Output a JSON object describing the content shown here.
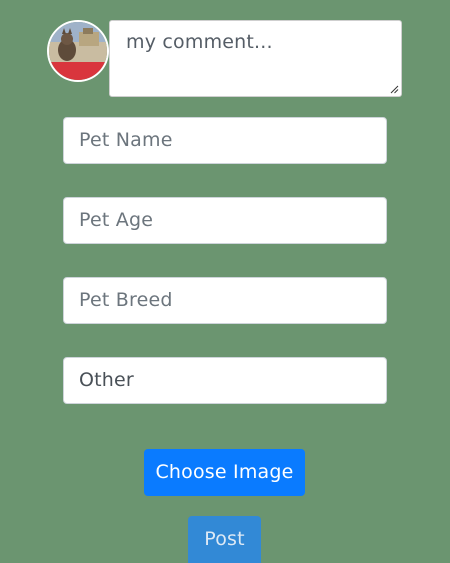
{
  "comment": {
    "placeholder": "my comment..."
  },
  "fields": {
    "pet_name_placeholder": "Pet Name",
    "pet_age_placeholder": "Pet Age",
    "pet_breed_placeholder": "Pet Breed",
    "other_value": "Other"
  },
  "buttons": {
    "choose_image_label": "Choose Image",
    "post_label": "Post"
  },
  "colors": {
    "background": "#6b9570",
    "primary_button": "#0a7bff",
    "post_button": "#3289d6"
  },
  "icons": {
    "avatar": "user-avatar-photo",
    "resize": "resize-grip-icon"
  }
}
